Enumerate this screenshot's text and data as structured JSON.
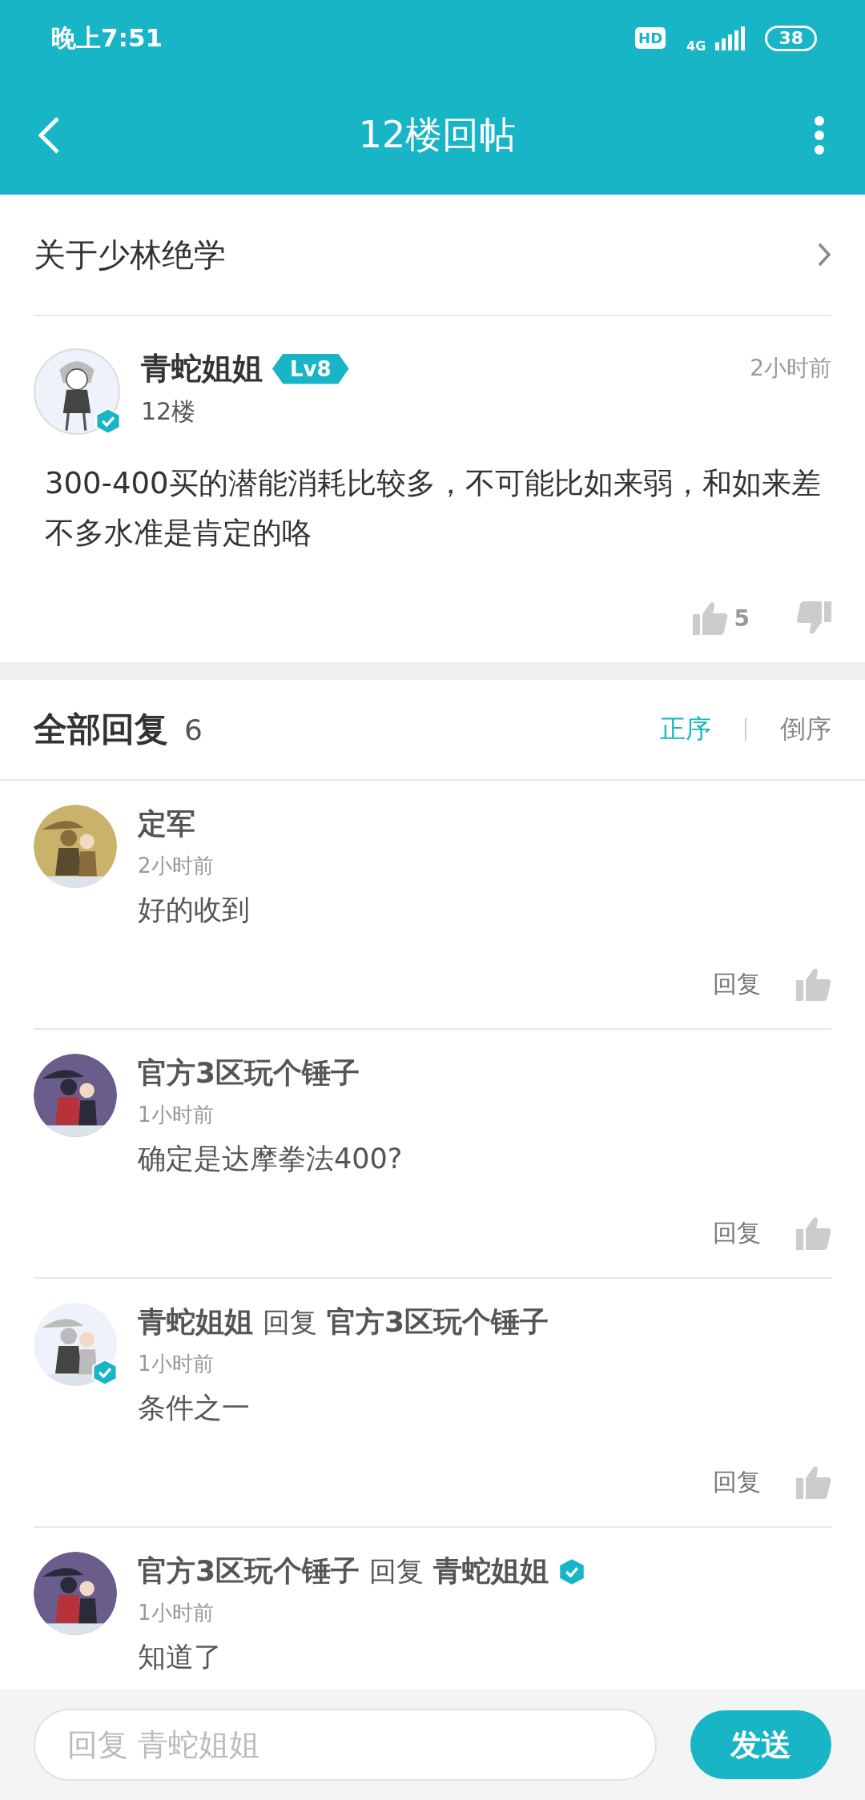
{
  "status_bar": {
    "time": "晚上7:51",
    "hd": "HD",
    "network": "4G",
    "battery": "38"
  },
  "header": {
    "title": "12楼回帖"
  },
  "topic": {
    "title": "关于少林绝学"
  },
  "post": {
    "author": "青蛇姐姐",
    "verified": true,
    "level": "Lv8",
    "time": "2小时前",
    "floor": "12楼",
    "text": "300-400买的潜能消耗比较多，不可能比如来弱，和如来差不多水准是肯定的咯",
    "likes": "5"
  },
  "replies": {
    "title": "全部回复",
    "count": "6",
    "sort": [
      {
        "label": "正序",
        "selected": true
      },
      {
        "label": "倒序",
        "selected": false
      }
    ]
  },
  "comments": [
    {
      "kind": "plain",
      "author": "定军",
      "author_verified": false,
      "time": "2小时前",
      "text": "好的收到",
      "reply_label": "回复"
    },
    {
      "kind": "plain",
      "author": "官方3区玩个锤子",
      "author_verified": false,
      "time": "1小时前",
      "text": "确定是达摩拳法400?",
      "reply_label": "回复"
    },
    {
      "kind": "reply",
      "author": "青蛇姐姐",
      "author_verified": true,
      "reply_word": "回复",
      "target": "官方3区玩个锤子",
      "target_verified": false,
      "time": "1小时前",
      "text": "条件之一",
      "reply_label": "回复"
    },
    {
      "kind": "reply",
      "author": "官方3区玩个锤子",
      "author_verified": false,
      "reply_word": "回复",
      "target": "青蛇姐姐",
      "target_verified": true,
      "time": "1小时前",
      "text": "知道了"
    }
  ],
  "composer": {
    "placeholder": "回复 青蛇姐姐",
    "send": "发送"
  }
}
